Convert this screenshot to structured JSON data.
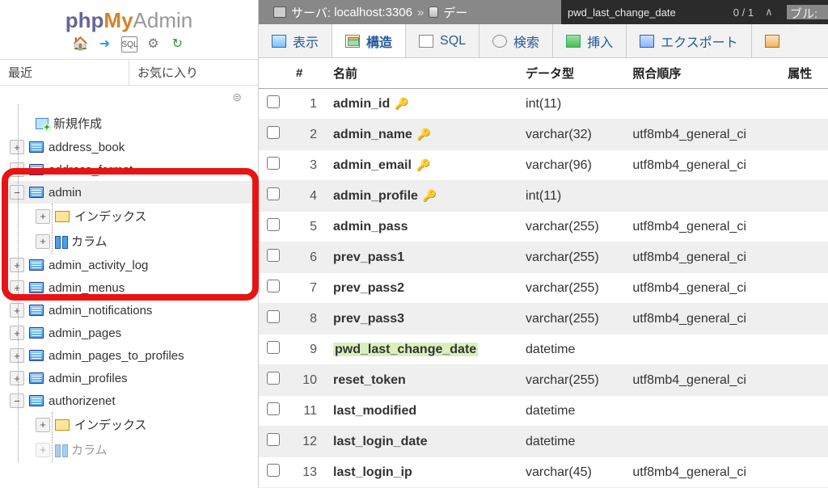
{
  "logo": {
    "p1": "php",
    "p2": "My",
    "p3": "Admin"
  },
  "recent": {
    "recent": "最近",
    "fav": "お気に入り"
  },
  "tree": {
    "new": "新規作成",
    "items": [
      "address_book",
      "address_format",
      "admin",
      "admin_activity_log",
      "admin_menus",
      "admin_notifications",
      "admin_pages",
      "admin_pages_to_profiles",
      "admin_profiles",
      "authorizenet"
    ],
    "indexes": "インデックス",
    "columns": "カラム"
  },
  "breadcrumb": {
    "server_label": "サーバ:",
    "server_value": "localhost:3306",
    "db_prefix": "デー",
    "tail": "ブル: a"
  },
  "find": {
    "term": "pwd_last_change_date",
    "count": "0 / 1",
    "up": "∧",
    "down": "∨",
    "close": "✕"
  },
  "tabs": {
    "browse": "表示",
    "structure": "構造",
    "sql": "SQL",
    "search": "検索",
    "insert": "挿入",
    "export": "エクスポート"
  },
  "columns_header": {
    "num": "#",
    "name": "名前",
    "type": "データ型",
    "collation": "照合順序",
    "attr": "属性"
  },
  "rows": [
    {
      "n": "1",
      "name": "admin_id",
      "key": "gold",
      "type": "int(11)",
      "coll": ""
    },
    {
      "n": "2",
      "name": "admin_name",
      "key": "grey",
      "type": "varchar(32)",
      "coll": "utf8mb4_general_ci"
    },
    {
      "n": "3",
      "name": "admin_email",
      "key": "grey",
      "type": "varchar(96)",
      "coll": "utf8mb4_general_ci"
    },
    {
      "n": "4",
      "name": "admin_profile",
      "key": "grey",
      "type": "int(11)",
      "coll": ""
    },
    {
      "n": "5",
      "name": "admin_pass",
      "key": "",
      "type": "varchar(255)",
      "coll": "utf8mb4_general_ci"
    },
    {
      "n": "6",
      "name": "prev_pass1",
      "key": "",
      "type": "varchar(255)",
      "coll": "utf8mb4_general_ci"
    },
    {
      "n": "7",
      "name": "prev_pass2",
      "key": "",
      "type": "varchar(255)",
      "coll": "utf8mb4_general_ci"
    },
    {
      "n": "8",
      "name": "prev_pass3",
      "key": "",
      "type": "varchar(255)",
      "coll": "utf8mb4_general_ci"
    },
    {
      "n": "9",
      "name": "pwd_last_change_date",
      "key": "",
      "type": "datetime",
      "coll": "",
      "hl": true
    },
    {
      "n": "10",
      "name": "reset_token",
      "key": "",
      "type": "varchar(255)",
      "coll": "utf8mb4_general_ci"
    },
    {
      "n": "11",
      "name": "last_modified",
      "key": "",
      "type": "datetime",
      "coll": ""
    },
    {
      "n": "12",
      "name": "last_login_date",
      "key": "",
      "type": "datetime",
      "coll": ""
    },
    {
      "n": "13",
      "name": "last_login_ip",
      "key": "",
      "type": "varchar(45)",
      "coll": "utf8mb4_general_ci"
    }
  ]
}
